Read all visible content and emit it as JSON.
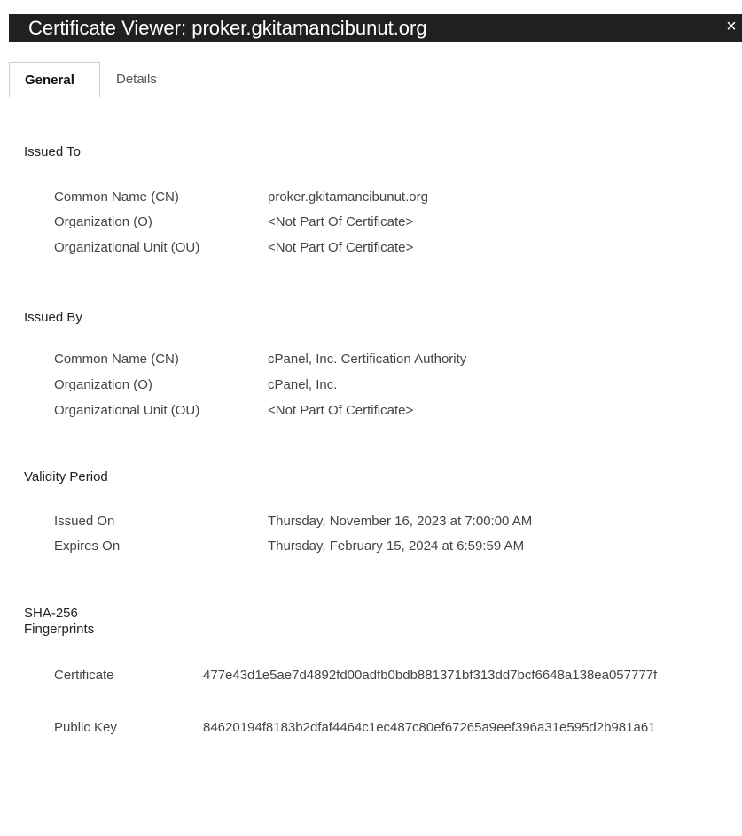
{
  "window": {
    "title": "Certificate Viewer: proker.gkitamancibunut.org",
    "close_glyph": "×"
  },
  "tabs": [
    {
      "label": "General",
      "selected": true
    },
    {
      "label": "Details",
      "selected": false
    }
  ],
  "issued_to": {
    "heading": "Issued To",
    "rows": [
      {
        "label": "Common Name (CN)",
        "value": "proker.gkitamancibunut.org"
      },
      {
        "label": "Organization (O)",
        "value": "<Not Part Of Certificate>"
      },
      {
        "label": "Organizational Unit (OU)",
        "value": "<Not Part Of Certificate>"
      }
    ]
  },
  "issued_by": {
    "heading": "Issued By",
    "rows": [
      {
        "label": "Common Name (CN)",
        "value": "cPanel, Inc. Certification Authority"
      },
      {
        "label": "Organization (O)",
        "value": "cPanel, Inc."
      },
      {
        "label": "Organizational Unit (OU)",
        "value": "<Not Part Of Certificate>"
      }
    ]
  },
  "validity": {
    "heading": "Validity Period",
    "rows": [
      {
        "label": "Issued On",
        "value": "Thursday, November 16, 2023 at 7:00:00 AM"
      },
      {
        "label": "Expires On",
        "value": "Thursday, February 15, 2024 at 6:59:59 AM"
      }
    ]
  },
  "fingerprints": {
    "heading_line1": "SHA-256",
    "heading_line2": "Fingerprints",
    "rows": [
      {
        "label": "Certificate",
        "value": "477e43d1e5ae7d4892fd00adfb0bdb881371bf313dd7bcf6648a138ea057777f"
      },
      {
        "label": "Public Key",
        "value": "84620194f8183b2dfaf4464c1ec487c80ef67265a9eef396a31e595d2b981a61"
      }
    ]
  }
}
